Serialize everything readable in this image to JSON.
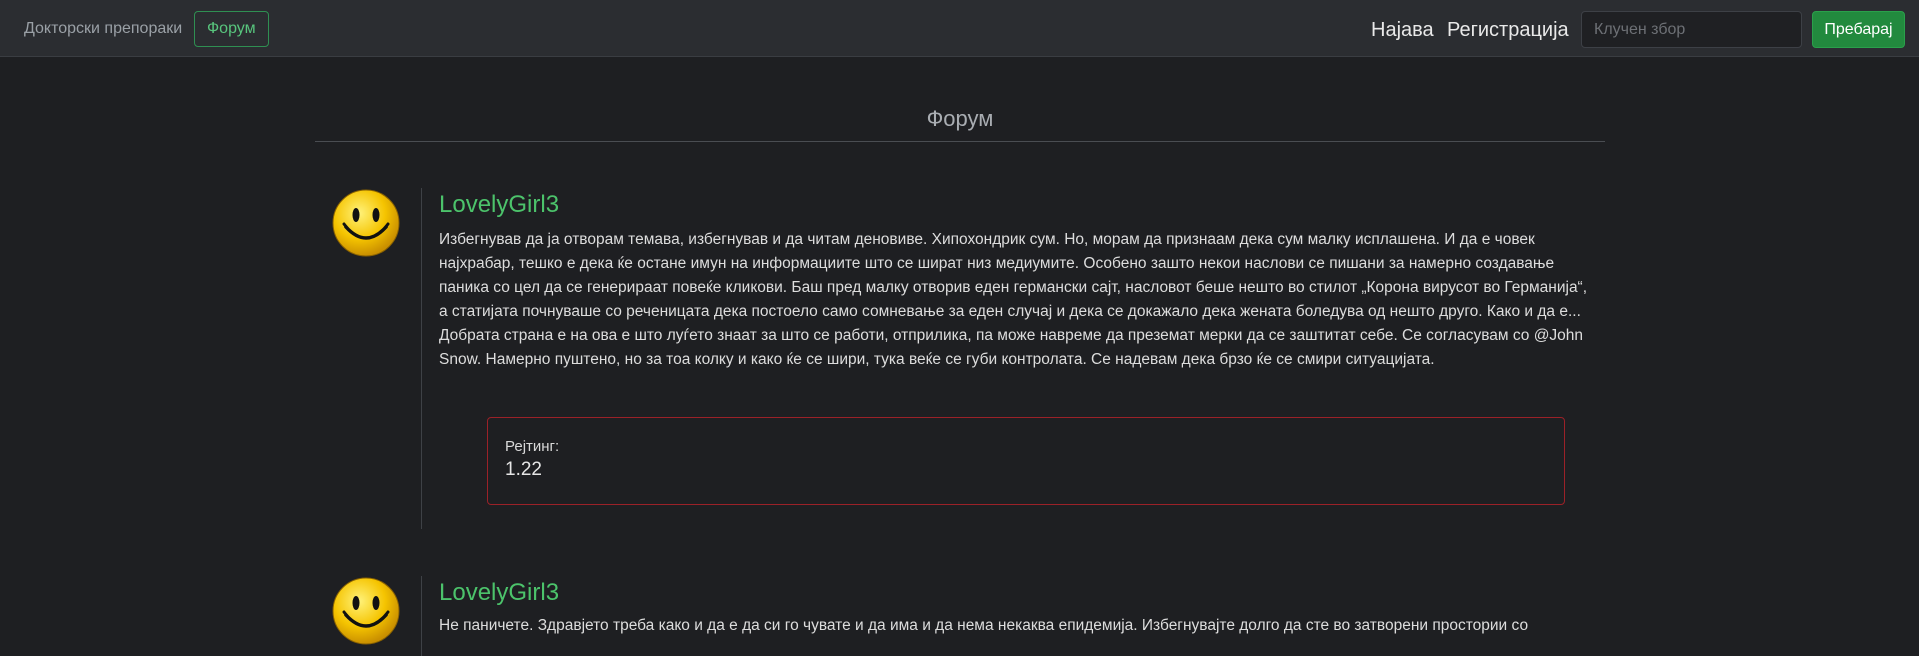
{
  "navbar": {
    "brand": "Докторски препораки",
    "forum_button": "Форум",
    "login": "Најава",
    "register": "Регистрација",
    "search_placeholder": "Клучен збор",
    "search_button": "Пребарај"
  },
  "main": {
    "title": "Форум",
    "posts": [
      {
        "author": "LovelyGirl3",
        "body": "Избегнував да ја отворам темава, избегнував и да читам деновиве. Хипохондрик сум. Но, морам да признаам дека сум малку исплашена. И да е човек најхрабар, тешко е дека ќе остане имун на информациите што се шират низ медиумите. Особено зашто некои наслови се пишани за намерно создавање паника со цел да се генерираат повеќе кликови. Баш пред малку отворив еден германски сајт, насловот беше нешто во стилот „Корона вирусот во Германија“, а статијата почнуваше со реченицата дека постоело само сомневање за еден случај и дека се докажало дека жената боледува од нешто друго. Како и да е... Добрата страна е на ова е што луѓето знаат за што се работи, отприлика, па може навреме да преземат мерки да се заштитат себе. Се согласувам со @John Snow. Намерно пуштено, но за тоа колку и како ќе се шири, тука веќе се губи контролата. Се надевам дека брзо ќе се смири ситуацијата.",
        "rating_label": "Рејтинг:",
        "rating_value": "1.22",
        "avatar_icon": "smiley-face-icon"
      },
      {
        "author": "LovelyGirl3",
        "body": "Не паничете. Здравјето треба како и да е да си го чувате и да има и да нема некаква епидемија. Избегнувајте долго да сте во затворени простории со",
        "avatar_icon": "smiley-face-icon"
      }
    ]
  },
  "colors": {
    "background": "#1e1f22",
    "navbar": "#2b2d31",
    "accent_green": "#4cc36b",
    "button_green": "#228a3e",
    "rating_border": "#9b2128"
  }
}
